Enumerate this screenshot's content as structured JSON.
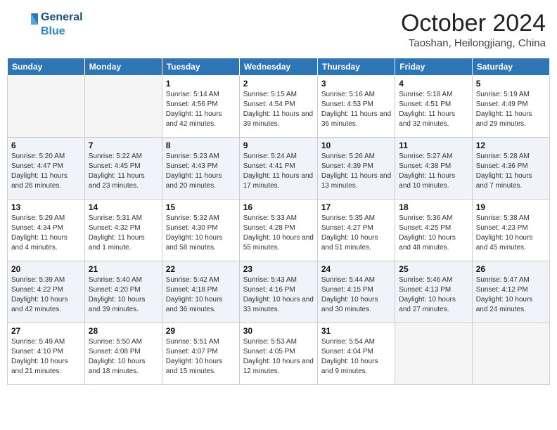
{
  "header": {
    "logo_general": "General",
    "logo_blue": "Blue",
    "month_title": "October 2024",
    "location": "Taoshan, Heilongjiang, China"
  },
  "weekdays": [
    "Sunday",
    "Monday",
    "Tuesday",
    "Wednesday",
    "Thursday",
    "Friday",
    "Saturday"
  ],
  "weeks": [
    [
      {
        "day": "",
        "empty": true
      },
      {
        "day": "",
        "empty": true
      },
      {
        "day": "1",
        "sunrise": "5:14 AM",
        "sunset": "4:56 PM",
        "daylight": "11 hours and 42 minutes."
      },
      {
        "day": "2",
        "sunrise": "5:15 AM",
        "sunset": "4:54 PM",
        "daylight": "11 hours and 39 minutes."
      },
      {
        "day": "3",
        "sunrise": "5:16 AM",
        "sunset": "4:53 PM",
        "daylight": "11 hours and 36 minutes."
      },
      {
        "day": "4",
        "sunrise": "5:18 AM",
        "sunset": "4:51 PM",
        "daylight": "11 hours and 32 minutes."
      },
      {
        "day": "5",
        "sunrise": "5:19 AM",
        "sunset": "4:49 PM",
        "daylight": "11 hours and 29 minutes."
      }
    ],
    [
      {
        "day": "6",
        "sunrise": "5:20 AM",
        "sunset": "4:47 PM",
        "daylight": "11 hours and 26 minutes."
      },
      {
        "day": "7",
        "sunrise": "5:22 AM",
        "sunset": "4:45 PM",
        "daylight": "11 hours and 23 minutes."
      },
      {
        "day": "8",
        "sunrise": "5:23 AM",
        "sunset": "4:43 PM",
        "daylight": "11 hours and 20 minutes."
      },
      {
        "day": "9",
        "sunrise": "5:24 AM",
        "sunset": "4:41 PM",
        "daylight": "11 hours and 17 minutes."
      },
      {
        "day": "10",
        "sunrise": "5:26 AM",
        "sunset": "4:39 PM",
        "daylight": "11 hours and 13 minutes."
      },
      {
        "day": "11",
        "sunrise": "5:27 AM",
        "sunset": "4:38 PM",
        "daylight": "11 hours and 10 minutes."
      },
      {
        "day": "12",
        "sunrise": "5:28 AM",
        "sunset": "4:36 PM",
        "daylight": "11 hours and 7 minutes."
      }
    ],
    [
      {
        "day": "13",
        "sunrise": "5:29 AM",
        "sunset": "4:34 PM",
        "daylight": "11 hours and 4 minutes."
      },
      {
        "day": "14",
        "sunrise": "5:31 AM",
        "sunset": "4:32 PM",
        "daylight": "11 hours and 1 minute."
      },
      {
        "day": "15",
        "sunrise": "5:32 AM",
        "sunset": "4:30 PM",
        "daylight": "10 hours and 58 minutes."
      },
      {
        "day": "16",
        "sunrise": "5:33 AM",
        "sunset": "4:28 PM",
        "daylight": "10 hours and 55 minutes."
      },
      {
        "day": "17",
        "sunrise": "5:35 AM",
        "sunset": "4:27 PM",
        "daylight": "10 hours and 51 minutes."
      },
      {
        "day": "18",
        "sunrise": "5:36 AM",
        "sunset": "4:25 PM",
        "daylight": "10 hours and 48 minutes."
      },
      {
        "day": "19",
        "sunrise": "5:38 AM",
        "sunset": "4:23 PM",
        "daylight": "10 hours and 45 minutes."
      }
    ],
    [
      {
        "day": "20",
        "sunrise": "5:39 AM",
        "sunset": "4:22 PM",
        "daylight": "10 hours and 42 minutes."
      },
      {
        "day": "21",
        "sunrise": "5:40 AM",
        "sunset": "4:20 PM",
        "daylight": "10 hours and 39 minutes."
      },
      {
        "day": "22",
        "sunrise": "5:42 AM",
        "sunset": "4:18 PM",
        "daylight": "10 hours and 36 minutes."
      },
      {
        "day": "23",
        "sunrise": "5:43 AM",
        "sunset": "4:16 PM",
        "daylight": "10 hours and 33 minutes."
      },
      {
        "day": "24",
        "sunrise": "5:44 AM",
        "sunset": "4:15 PM",
        "daylight": "10 hours and 30 minutes."
      },
      {
        "day": "25",
        "sunrise": "5:46 AM",
        "sunset": "4:13 PM",
        "daylight": "10 hours and 27 minutes."
      },
      {
        "day": "26",
        "sunrise": "5:47 AM",
        "sunset": "4:12 PM",
        "daylight": "10 hours and 24 minutes."
      }
    ],
    [
      {
        "day": "27",
        "sunrise": "5:49 AM",
        "sunset": "4:10 PM",
        "daylight": "10 hours and 21 minutes."
      },
      {
        "day": "28",
        "sunrise": "5:50 AM",
        "sunset": "4:08 PM",
        "daylight": "10 hours and 18 minutes."
      },
      {
        "day": "29",
        "sunrise": "5:51 AM",
        "sunset": "4:07 PM",
        "daylight": "10 hours and 15 minutes."
      },
      {
        "day": "30",
        "sunrise": "5:53 AM",
        "sunset": "4:05 PM",
        "daylight": "10 hours and 12 minutes."
      },
      {
        "day": "31",
        "sunrise": "5:54 AM",
        "sunset": "4:04 PM",
        "daylight": "10 hours and 9 minutes."
      },
      {
        "day": "",
        "empty": true
      },
      {
        "day": "",
        "empty": true
      }
    ]
  ],
  "labels": {
    "sunrise": "Sunrise:",
    "sunset": "Sunset:",
    "daylight": "Daylight:"
  }
}
